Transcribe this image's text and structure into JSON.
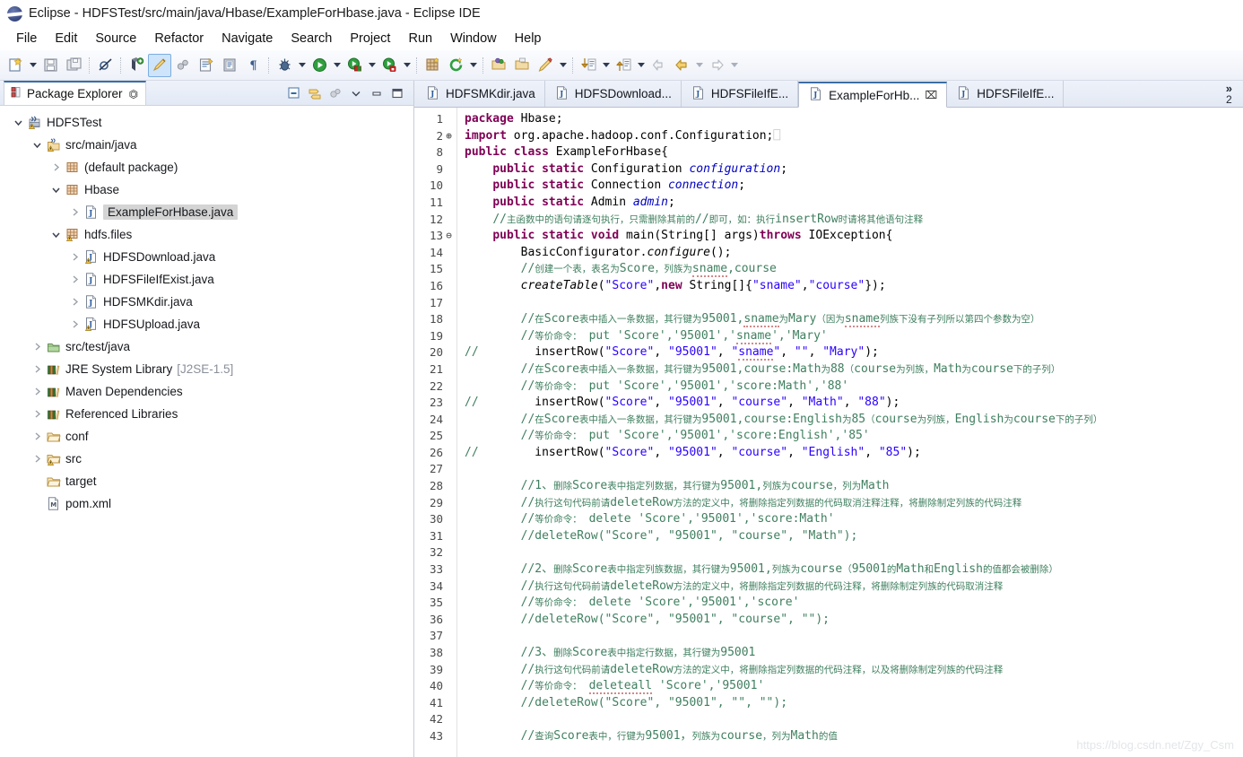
{
  "window": {
    "title": "Eclipse - HDFSTest/src/main/java/Hbase/ExampleForHbase.java - Eclipse IDE",
    "logo_icon": "eclipse-logo-icon"
  },
  "menubar": {
    "items": [
      "File",
      "Edit",
      "Source",
      "Refactor",
      "Navigate",
      "Search",
      "Project",
      "Run",
      "Window",
      "Help"
    ]
  },
  "toolbar": {
    "groups": [
      {
        "items": [
          {
            "icon": "new-wizard-icon",
            "dropdown": true
          },
          {
            "icon": "save-icon",
            "dropdown": false
          },
          {
            "icon": "save-all-icon",
            "dropdown": false
          }
        ]
      },
      {
        "items": [
          {
            "icon": "skip-all-breakpoints-icon",
            "dropdown": false
          }
        ]
      },
      {
        "items": [
          {
            "icon": "new-java-package-icon",
            "dropdown": false
          },
          {
            "icon": "toggle-mark-occurrences-icon",
            "dropdown": false,
            "active": true
          },
          {
            "icon": "link-with-editor-icon",
            "dropdown": false
          },
          {
            "icon": "open-type-icon",
            "dropdown": false
          },
          {
            "icon": "open-task-icon",
            "dropdown": false
          },
          {
            "icon": "show-whitespace-icon",
            "dropdown": false
          }
        ]
      },
      {
        "items": [
          {
            "icon": "debug-icon",
            "dropdown": true
          },
          {
            "icon": "run-icon",
            "dropdown": true
          },
          {
            "icon": "run-external-tools-icon",
            "dropdown": true
          },
          {
            "icon": "coverage-icon",
            "dropdown": true
          }
        ]
      },
      {
        "items": [
          {
            "icon": "new-package-presentation-icon",
            "dropdown": false
          },
          {
            "icon": "search-refresh-icon",
            "dropdown": true
          }
        ]
      },
      {
        "items": [
          {
            "icon": "open-resource-icon",
            "dropdown": false
          },
          {
            "icon": "open-folder-icon",
            "dropdown": false
          },
          {
            "icon": "pencil-icon",
            "dropdown": true
          }
        ]
      },
      {
        "items": [
          {
            "icon": "next-annotation-icon",
            "dropdown": true
          },
          {
            "icon": "previous-annotation-icon",
            "dropdown": true
          },
          {
            "icon": "back-history-disabled-icon",
            "dropdown": false
          },
          {
            "icon": "back-history-icon",
            "dropdown": true
          },
          {
            "icon": "forward-history-icon",
            "dropdown": true
          }
        ]
      }
    ]
  },
  "explorer": {
    "title": "Package Explorer",
    "pin_icon": "view-pin-icon",
    "tools": [
      {
        "icon": "collapse-all-icon"
      },
      {
        "icon": "link-with-editor-icon"
      },
      {
        "icon": "focus-on-active-task-icon"
      },
      {
        "icon": "view-menu-chevron-icon"
      },
      {
        "icon": "minimize-view-icon"
      },
      {
        "icon": "maximize-view-icon"
      }
    ],
    "tree": [
      {
        "label": "HDFSTest",
        "indent": 0,
        "twisty": "open",
        "icon": "java-project-icon",
        "selected": false
      },
      {
        "label": "src/main/java",
        "indent": 1,
        "twisty": "open",
        "icon": "source-folder-icon",
        "selected": false
      },
      {
        "label": "(default package)",
        "indent": 2,
        "twisty": "closed",
        "icon": "package-icon",
        "selected": false
      },
      {
        "label": "Hbase",
        "indent": 2,
        "twisty": "open",
        "icon": "package-icon",
        "selected": false
      },
      {
        "label": "ExampleForHbase.java",
        "indent": 3,
        "twisty": "closed",
        "icon": "java-file-icon",
        "selected": true
      },
      {
        "label": "hdfs.files",
        "indent": 2,
        "twisty": "open",
        "icon": "package-warn-icon",
        "selected": false
      },
      {
        "label": "HDFSDownload.java",
        "indent": 3,
        "twisty": "closed",
        "icon": "java-file-warn-icon",
        "selected": false
      },
      {
        "label": "HDFSFileIfExist.java",
        "indent": 3,
        "twisty": "closed",
        "icon": "java-file-icon",
        "selected": false
      },
      {
        "label": "HDFSMKdir.java",
        "indent": 3,
        "twisty": "closed",
        "icon": "java-file-icon",
        "selected": false
      },
      {
        "label": "HDFSUpload.java",
        "indent": 3,
        "twisty": "closed",
        "icon": "java-file-warn-icon",
        "selected": false
      },
      {
        "label": "src/test/java",
        "indent": 1,
        "twisty": "closed",
        "icon": "source-folder-green-icon",
        "selected": false
      },
      {
        "label": "JRE System Library",
        "suffix": "[J2SE-1.5]",
        "indent": 1,
        "twisty": "closed",
        "icon": "library-icon",
        "selected": false
      },
      {
        "label": "Maven Dependencies",
        "indent": 1,
        "twisty": "closed",
        "icon": "library-icon",
        "selected": false
      },
      {
        "label": "Referenced Libraries",
        "indent": 1,
        "twisty": "closed",
        "icon": "library-icon",
        "selected": false
      },
      {
        "label": "conf",
        "indent": 1,
        "twisty": "closed",
        "icon": "folder-icon",
        "selected": false
      },
      {
        "label": "src",
        "indent": 1,
        "twisty": "closed",
        "icon": "folder-warn-icon",
        "selected": false
      },
      {
        "label": "target",
        "indent": 1,
        "twisty": "none",
        "icon": "folder-icon",
        "selected": false
      },
      {
        "label": "pom.xml",
        "indent": 1,
        "twisty": "none",
        "icon": "maven-pom-icon",
        "selected": false
      }
    ]
  },
  "editor": {
    "tabs": [
      {
        "label": "HDFSMKdir.java",
        "icon": "java-file-icon",
        "active": false,
        "closable": false
      },
      {
        "label": "HDFSDownload...",
        "icon": "java-file-icon",
        "active": false,
        "closable": false
      },
      {
        "label": "HDFSFileIfE...",
        "icon": "java-file-icon",
        "active": false,
        "closable": false
      },
      {
        "label": "ExampleForHb...",
        "icon": "java-file-icon",
        "active": true,
        "closable": true
      },
      {
        "label": "HDFSFileIfE...",
        "icon": "java-file-icon",
        "active": false,
        "closable": false
      }
    ],
    "overflow": {
      "chevron": "»",
      "count": "2"
    },
    "watermark": "https://blog.csdn.net/Zgy_Csm",
    "lines": [
      {
        "n": "1",
        "mark": "",
        "html": "<span class=\"kw\">package</span> Hbase;"
      },
      {
        "n": "2",
        "mark": "⊕",
        "html": "<span class=\"kw\">import</span> org.apache.hadoop.conf.Configuration;<span style=\"color:#c8c8c8\">⎕</span>"
      },
      {
        "n": "8",
        "mark": "",
        "html": "<span class=\"kw\">public class</span> ExampleForHbase{"
      },
      {
        "n": "9",
        "mark": "",
        "html": "    <span class=\"kw\">public static</span> Configuration <span class=\"fld\">configuration</span>;"
      },
      {
        "n": "10",
        "mark": "",
        "html": "    <span class=\"kw\">public static</span> Connection <span class=\"fld\">connection</span>;"
      },
      {
        "n": "11",
        "mark": "",
        "html": "    <span class=\"kw\">public static</span> Admin <span class=\"fld\">admin</span>;"
      },
      {
        "n": "12",
        "mark": "",
        "html": "    <span class=\"cmt\">//<span class=\"cmt-cn\">主函数中的语句请逐句执行，只需删除其前的</span>//<span class=\"cmt-cn\">即可，如：执行</span>insertRow<span class=\"cmt-cn\">时请将其他语句注释</span></span>"
      },
      {
        "n": "13",
        "mark": "⊖",
        "html": "    <span class=\"kw\">public static void</span> main(String[] args)<span class=\"kw\">throws</span> IOException{"
      },
      {
        "n": "14",
        "mark": "",
        "html": "        BasicConfigurator.<span class=\"mth\">configure</span>();"
      },
      {
        "n": "15",
        "mark": "",
        "html": "        <span class=\"cmt\">//<span class=\"cmt-cn\">创建一个表，表名为</span>Score<span class=\"cmt-cn\">，列族为</span><span class=\"sq\">sname</span>,course</span>"
      },
      {
        "n": "16",
        "mark": "",
        "html": "        <span class=\"mth\">createTable</span>(<span class=\"str\">\"Score\"</span>,<span class=\"kw\">new</span> String[]{<span class=\"str\">\"sname\"</span>,<span class=\"str\">\"course\"</span>});"
      },
      {
        "n": "17",
        "mark": "",
        "html": ""
      },
      {
        "n": "18",
        "mark": "",
        "html": "        <span class=\"cmt\">//<span class=\"cmt-cn\">在</span>Score<span class=\"cmt-cn\">表中插入一条数据，其行键为</span>95001,<span class=\"sq\">sname</span><span class=\"cmt-cn\">为</span>Mary<span class=\"cmt-cn\">（因为</span><span class=\"sq\">sname</span><span class=\"cmt-cn\">列族下没有子列所以第四个参数为空）</span></span>"
      },
      {
        "n": "19",
        "mark": "",
        "html": "        <span class=\"cmt\">//<span class=\"cmt-cn\">等价命令：</span> put 'Score','95001','<span class=\"sq\">sname</span>','Mary'</span>"
      },
      {
        "n": "20",
        "mark": "",
        "html": "<span class=\"cmt\">//</span>        insertRow(<span class=\"str\">\"Score\"</span>, <span class=\"str\">\"95001\"</span>, <span class=\"str\">\"<span class=\"sq\">sname</span>\"</span>, <span class=\"str\">\"\"</span>, <span class=\"str\">\"Mary\"</span>);"
      },
      {
        "n": "21",
        "mark": "",
        "html": "        <span class=\"cmt\">//<span class=\"cmt-cn\">在</span>Score<span class=\"cmt-cn\">表中插入一条数据，其行键为</span>95001,course:Math<span class=\"cmt-cn\">为</span>88<span class=\"cmt-cn\">（</span>course<span class=\"cmt-cn\">为列族，</span>Math<span class=\"cmt-cn\">为</span>course<span class=\"cmt-cn\">下的子列）</span></span>"
      },
      {
        "n": "22",
        "mark": "",
        "html": "        <span class=\"cmt\">//<span class=\"cmt-cn\">等价命令：</span> put 'Score','95001','score:Math','88'</span>"
      },
      {
        "n": "23",
        "mark": "",
        "html": "<span class=\"cmt\">//</span>        insertRow(<span class=\"str\">\"Score\"</span>, <span class=\"str\">\"95001\"</span>, <span class=\"str\">\"course\"</span>, <span class=\"str\">\"Math\"</span>, <span class=\"str\">\"88\"</span>);"
      },
      {
        "n": "24",
        "mark": "",
        "html": "        <span class=\"cmt\">//<span class=\"cmt-cn\">在</span>Score<span class=\"cmt-cn\">表中插入一条数据，其行键为</span>95001,course:English<span class=\"cmt-cn\">为</span>85<span class=\"cmt-cn\">（</span>course<span class=\"cmt-cn\">为列族，</span>English<span class=\"cmt-cn\">为</span>course<span class=\"cmt-cn\">下的子列）</span></span>"
      },
      {
        "n": "25",
        "mark": "",
        "html": "        <span class=\"cmt\">//<span class=\"cmt-cn\">等价命令：</span> put 'Score','95001','score:English','85'</span>"
      },
      {
        "n": "26",
        "mark": "",
        "html": "<span class=\"cmt\">//</span>        insertRow(<span class=\"str\">\"Score\"</span>, <span class=\"str\">\"95001\"</span>, <span class=\"str\">\"course\"</span>, <span class=\"str\">\"English\"</span>, <span class=\"str\">\"85\"</span>);"
      },
      {
        "n": "27",
        "mark": "",
        "html": ""
      },
      {
        "n": "28",
        "mark": "",
        "html": "        <span class=\"cmt\">//1、<span class=\"cmt-cn\">删除</span>Score<span class=\"cmt-cn\">表中指定列数据，其行键为</span>95001,<span class=\"cmt-cn\">列族为</span>course<span class=\"cmt-cn\">，列为</span>Math</span>"
      },
      {
        "n": "29",
        "mark": "",
        "html": "        <span class=\"cmt\">//<span class=\"cmt-cn\">执行这句代码前请</span>deleteRow<span class=\"cmt-cn\">方法的定义中，将删除指定列数据的代码取消注释注释，将删除制定列族的代码注释</span></span>"
      },
      {
        "n": "30",
        "mark": "",
        "html": "        <span class=\"cmt\">//<span class=\"cmt-cn\">等价命令：</span> delete 'Score','95001','score:Math'</span>"
      },
      {
        "n": "31",
        "mark": "",
        "html": "        <span class=\"cmt\">//deleteRow(\"Score\", \"95001\", \"course\", \"Math\");</span>"
      },
      {
        "n": "32",
        "mark": "",
        "html": ""
      },
      {
        "n": "33",
        "mark": "",
        "html": "        <span class=\"cmt\">//2、<span class=\"cmt-cn\">删除</span>Score<span class=\"cmt-cn\">表中指定列族数据，其行键为</span>95001,<span class=\"cmt-cn\">列族为</span>course<span class=\"cmt-cn\">（</span>95001<span class=\"cmt-cn\">的</span>Math<span class=\"cmt-cn\">和</span>English<span class=\"cmt-cn\">的值都会被删除）</span></span>"
      },
      {
        "n": "34",
        "mark": "",
        "html": "        <span class=\"cmt\">//<span class=\"cmt-cn\">执行这句代码前请</span>deleteRow<span class=\"cmt-cn\">方法的定义中，将删除指定列数据的代码注释，将删除制定列族的代码取消注释</span></span>"
      },
      {
        "n": "35",
        "mark": "",
        "html": "        <span class=\"cmt\">//<span class=\"cmt-cn\">等价命令：</span> delete 'Score','95001','score'</span>"
      },
      {
        "n": "36",
        "mark": "",
        "html": "        <span class=\"cmt\">//deleteRow(\"Score\", \"95001\", \"course\", \"\");</span>"
      },
      {
        "n": "37",
        "mark": "",
        "html": ""
      },
      {
        "n": "38",
        "mark": "",
        "html": "        <span class=\"cmt\">//3、<span class=\"cmt-cn\">删除</span>Score<span class=\"cmt-cn\">表中指定行数据，其行键为</span>95001</span>"
      },
      {
        "n": "39",
        "mark": "",
        "html": "        <span class=\"cmt\">//<span class=\"cmt-cn\">执行这句代码前请</span>deleteRow<span class=\"cmt-cn\">方法的定义中，将删除指定列数据的代码注释，以及将删除制定列族的代码注释</span></span>"
      },
      {
        "n": "40",
        "mark": "",
        "html": "        <span class=\"cmt\">//<span class=\"cmt-cn\">等价命令：</span> <span class=\"sq\">deleteall</span> 'Score','95001'</span>"
      },
      {
        "n": "41",
        "mark": "",
        "html": "        <span class=\"cmt\">//deleteRow(\"Score\", \"95001\", \"\", \"\");</span>"
      },
      {
        "n": "42",
        "mark": "",
        "html": ""
      },
      {
        "n": "43",
        "mark": "",
        "html": "        <span class=\"cmt\">//<span class=\"cmt-cn\">查询</span>Score<span class=\"cmt-cn\">表中，行键为</span>95001，<span class=\"cmt-cn\">列族为</span>course<span class=\"cmt-cn\">，列为</span>Math<span class=\"cmt-cn\">的值</span></span>"
      }
    ]
  },
  "colors": {
    "keyword": "#7f0055",
    "field": "#0000c0",
    "string": "#2a00ff",
    "comment": "#3f7f5f",
    "tab_accent": "#3a6ea5",
    "selection": "#d4d4d4"
  }
}
